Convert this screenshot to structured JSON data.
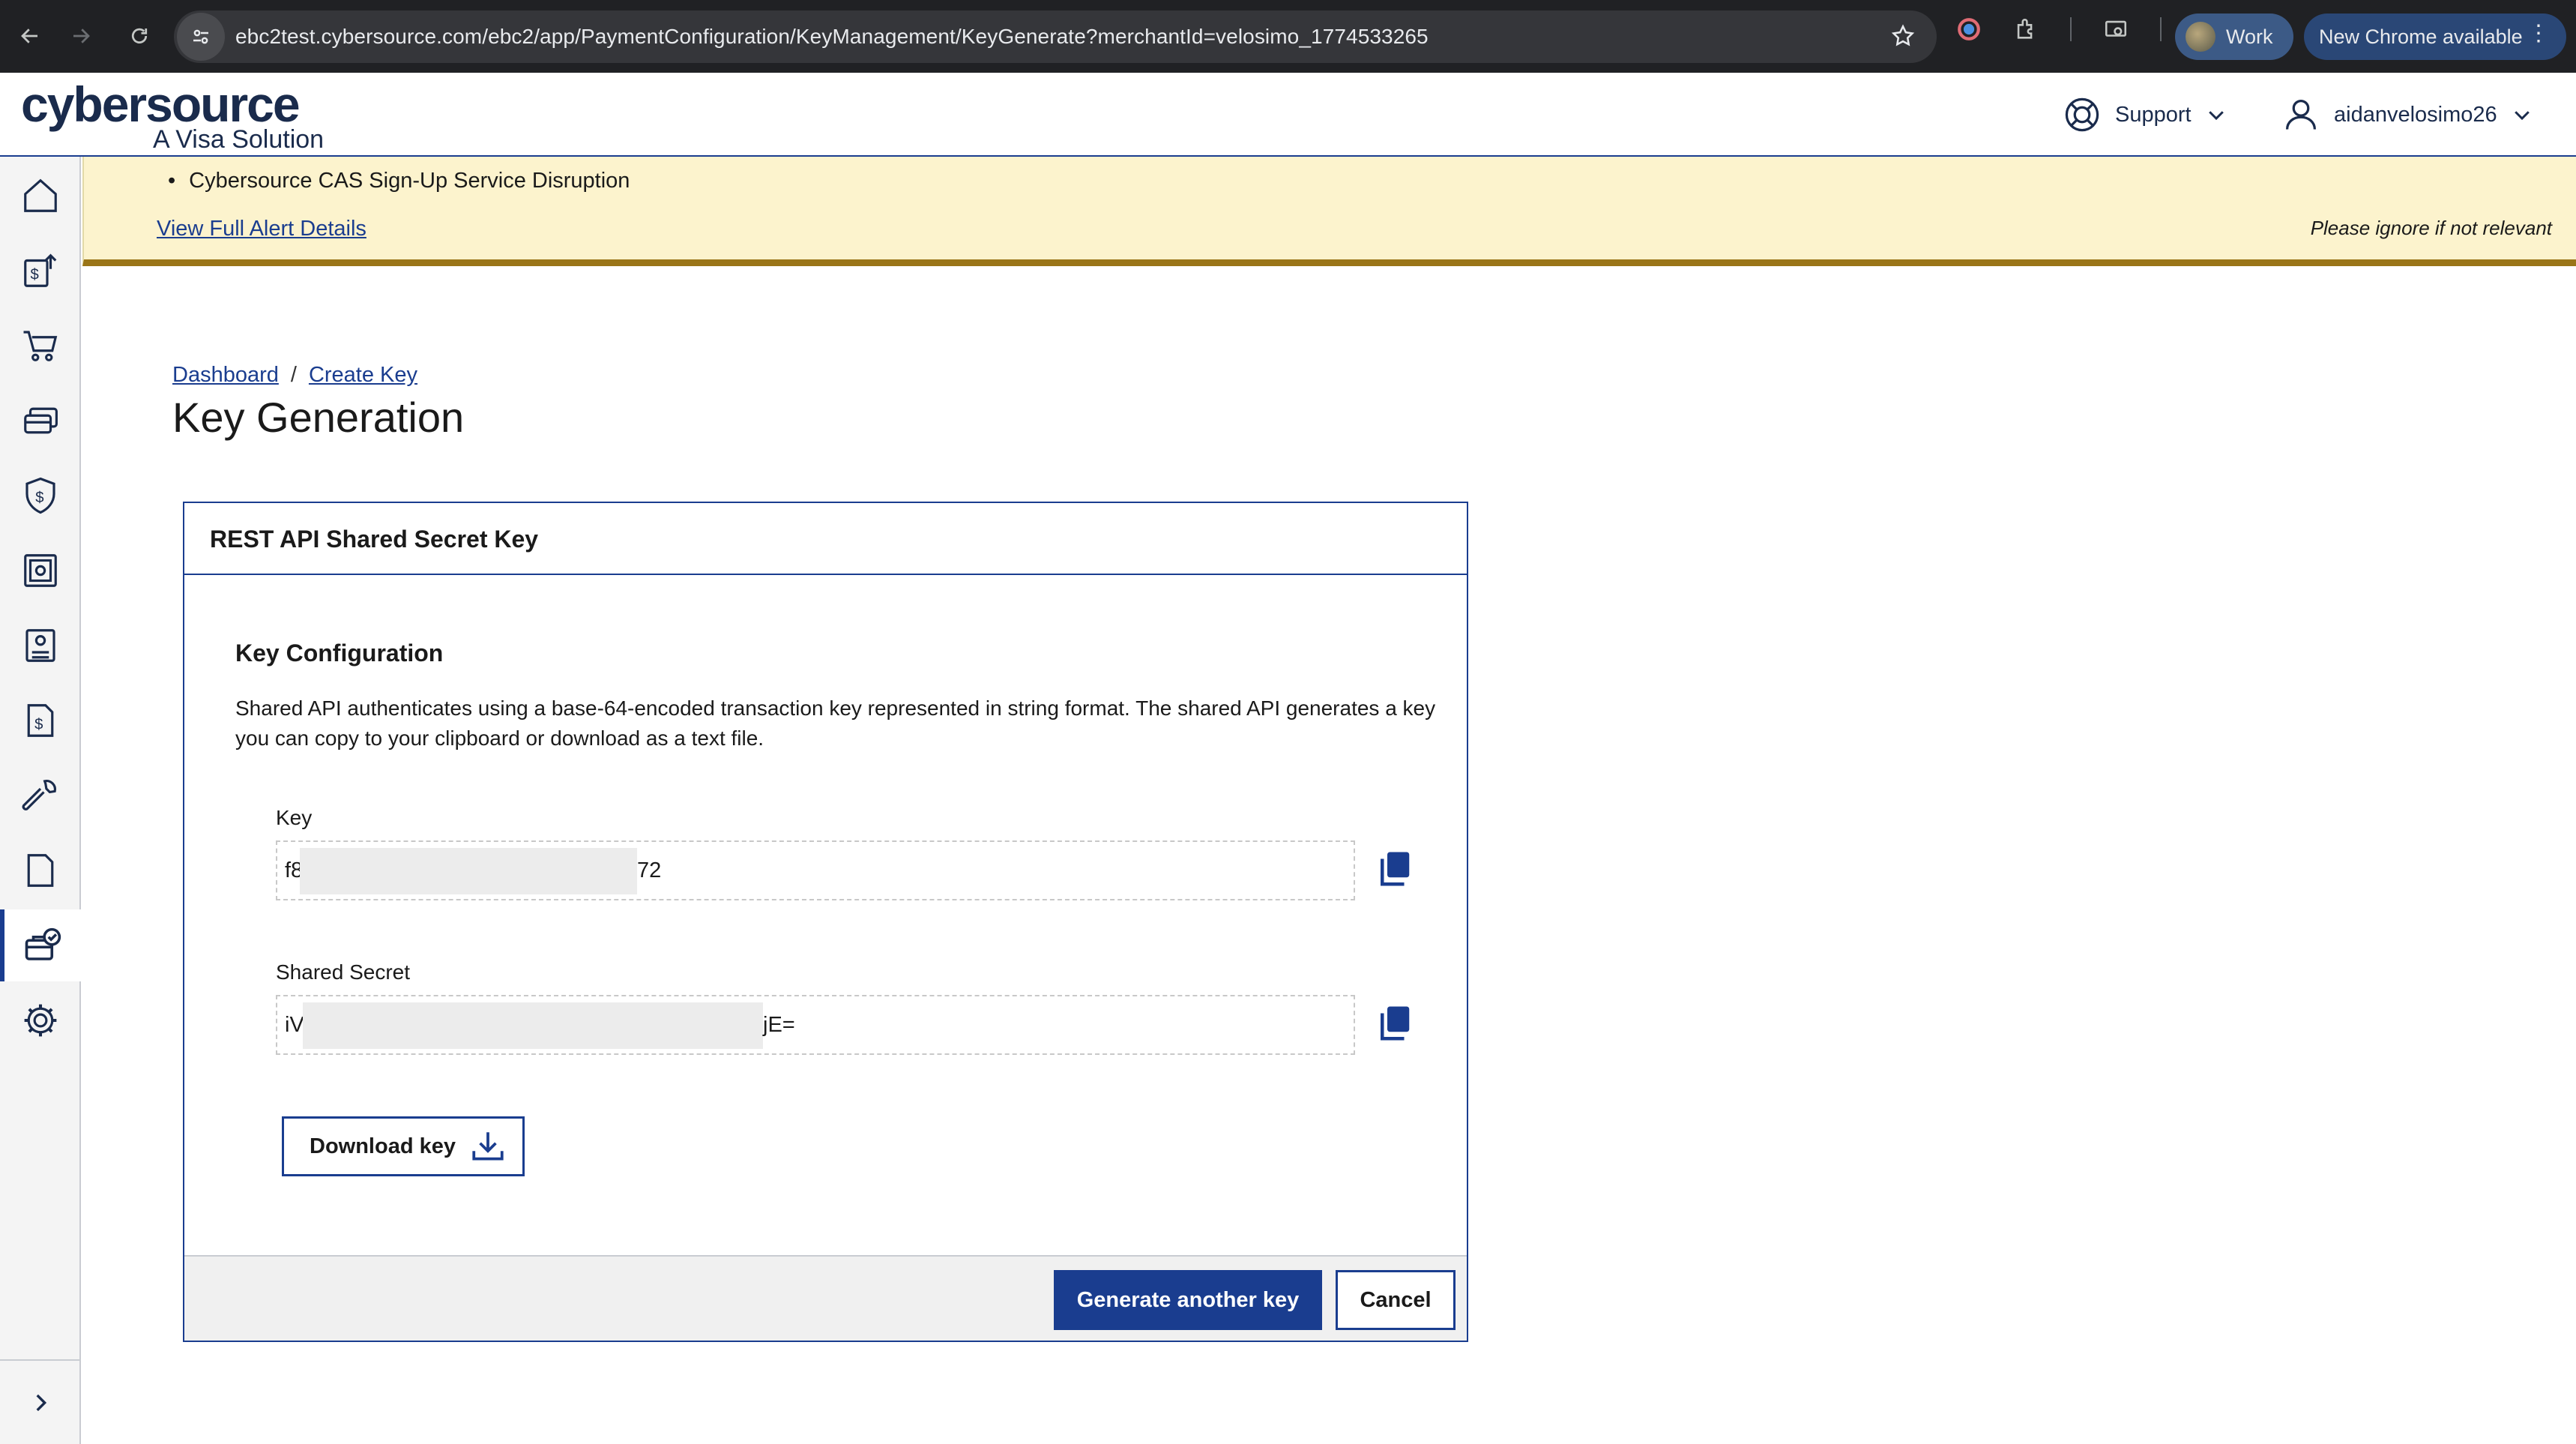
{
  "browser": {
    "url": "ebc2test.cybersource.com/ebc2/app/PaymentConfiguration/KeyManagement/KeyGenerate?merchantId=velosimo_1774533265",
    "profile_label": "Work",
    "update_label": "New Chrome available"
  },
  "header": {
    "brand": "cybersource",
    "tagline": "A Visa Solution",
    "support_label": "Support",
    "user_label": "aidanvelosimo26"
  },
  "sidebar": {
    "items": [
      {
        "icon": "home-icon"
      },
      {
        "icon": "payments-icon"
      },
      {
        "icon": "cart-icon"
      },
      {
        "icon": "cards-icon"
      },
      {
        "icon": "fraud-shield-icon"
      },
      {
        "icon": "vault-icon"
      },
      {
        "icon": "terminal-icon"
      },
      {
        "icon": "invoice-icon"
      },
      {
        "icon": "tools-icon"
      },
      {
        "icon": "document-icon"
      },
      {
        "icon": "payment-config-icon",
        "active": true
      },
      {
        "icon": "settings-icon"
      }
    ],
    "expand_icon": "chevron-right-icon"
  },
  "alert": {
    "item": "Cybersource CAS Sign-Up Service Disruption",
    "link_label": "View Full Alert Details",
    "note": "Please ignore if not relevant"
  },
  "breadcrumb": {
    "dashboard": "Dashboard",
    "separator": "/",
    "current": "Create Key"
  },
  "page": {
    "title": "Key Generation"
  },
  "card": {
    "title": "REST API Shared Secret Key",
    "section_title": "Key Configuration",
    "description": "Shared API authenticates using a base-64-encoded transaction key represented in string format. The shared API generates a key you can copy to your clipboard or download as a text file.",
    "key": {
      "label": "Key",
      "value_start": "f8",
      "value_end": "72"
    },
    "secret": {
      "label": "Shared Secret",
      "value_start": "iV:",
      "value_end": "jE="
    },
    "download_label": "Download key",
    "generate_label": "Generate another key",
    "cancel_label": "Cancel"
  },
  "colors": {
    "primary": "#1a3d8f",
    "alert_bg": "#fcf3cd",
    "alert_border": "#9a7518",
    "chrome_bg": "#202124"
  }
}
